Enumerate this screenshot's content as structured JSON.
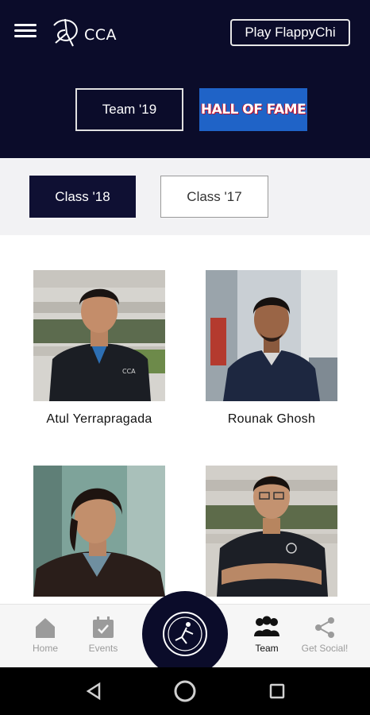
{
  "header": {
    "logo_text": "CCA",
    "play_button": "Play FlappyChi",
    "team_button": "Team '19",
    "hof_button": "HALL OF FAME",
    "colors": {
      "background": "#0b0c2a",
      "hof": "#1f63c7"
    }
  },
  "classes": {
    "selected": "Class '18",
    "other": "Class '17"
  },
  "members": [
    {
      "name": "Atul Yerrapragada"
    },
    {
      "name": "Rounak Ghosh"
    },
    {
      "name": ""
    },
    {
      "name": ""
    }
  ],
  "bottom_nav": {
    "items": [
      {
        "label": "Home",
        "icon": "home-icon"
      },
      {
        "label": "Events",
        "icon": "calendar-icon"
      },
      {
        "label": "Team",
        "icon": "team-icon",
        "active": true
      },
      {
        "label": "Get Social!",
        "icon": "share-icon"
      }
    ]
  }
}
